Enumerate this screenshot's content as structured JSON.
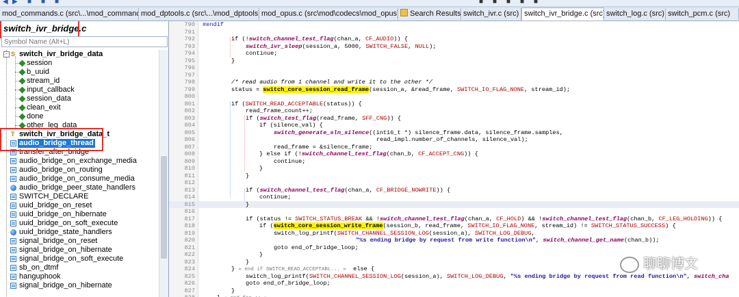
{
  "tabs": [
    {
      "label": "mod_commands.c (src\\...\\mod_commands)"
    },
    {
      "label": "mod_dptools.c (src\\...\\mod_dptools)"
    },
    {
      "label": "mod_opus.c (src\\mod\\codecs\\mod_opus)"
    },
    {
      "label": "Search Results"
    },
    {
      "label": "switch_ivr.c (src)"
    },
    {
      "label": "switch_ivr_bridge.c (src)",
      "close": "×"
    },
    {
      "label": "switch_log.c (src)"
    },
    {
      "label": "switch_pcm.c (src)"
    }
  ],
  "panel": {
    "title": "switch_ivr_bridge.c",
    "search_placeholder": "Symbol Name (Alt+L)"
  },
  "tree": [
    {
      "label": "switch_ivr_bridge_data",
      "expander": "-"
    },
    {
      "label": "session"
    },
    {
      "label": "b_uuid"
    },
    {
      "label": "stream_id"
    },
    {
      "label": "input_callback"
    },
    {
      "label": "session_data"
    },
    {
      "label": "clean_exit"
    },
    {
      "label": "done"
    },
    {
      "label": "other_leg_data"
    },
    {
      "label": "switch_ivr_bridge_data_t"
    },
    {
      "label": "audio_bridge_thread"
    },
    {
      "label": "transfer_after_bridge"
    },
    {
      "label": "audio_bridge_on_exchange_media"
    },
    {
      "label": "audio_bridge_on_routing"
    },
    {
      "label": "audio_bridge_on_consume_media"
    },
    {
      "label": "audio_bridge_peer_state_handlers"
    },
    {
      "label": "SWITCH_DECLARE"
    },
    {
      "label": "uuid_bridge_on_reset"
    },
    {
      "label": "uuid_bridge_on_hibernate"
    },
    {
      "label": "uuid_bridge_on_soft_execute"
    },
    {
      "label": "uuid_bridge_state_handlers"
    },
    {
      "label": "signal_bridge_on_reset"
    },
    {
      "label": "signal_bridge_on_hibernate"
    },
    {
      "label": "signal_bridge_on_soft_execute"
    },
    {
      "label": "sb_on_dtmf"
    },
    {
      "label": "hanguphook"
    },
    {
      "label": "signal_bridge_on_hibernate"
    }
  ],
  "code": [
    {
      "n": "790",
      "t": "#endif"
    },
    {
      "n": "791",
      "t": ""
    },
    {
      "n": "792",
      "t": "if (!switch_channel_test_flag(chan_a, CF_AUDIO)) {"
    },
    {
      "n": "793",
      "t": "switch_ivr_sleep(session_a, 5000, SWITCH_FALSE, NULL);"
    },
    {
      "n": "794",
      "t": "continue;"
    },
    {
      "n": "795",
      "t": "}"
    },
    {
      "n": "796",
      "t": ""
    },
    {
      "n": "797",
      "t": ""
    },
    {
      "n": "798",
      "t": "/* read audio from 1 channel and write it to the other */"
    },
    {
      "n": "799",
      "t": "status = switch_core_session_read_frame(session_a, &read_frame, SWITCH_IO_FLAG_NONE, stream_id);"
    },
    {
      "n": "800",
      "t": ""
    },
    {
      "n": "801",
      "t": "if (SWITCH_READ_ACCEPTABLE(status)) {"
    },
    {
      "n": "802",
      "t": "read_frame_count++;"
    },
    {
      "n": "803",
      "t": "if (switch_test_flag(read_frame, SFF_CNG)) {"
    },
    {
      "n": "804",
      "t": "if (silence_val) {"
    },
    {
      "n": "805",
      "t": "switch_generate_sln_silence((int16_t *) silence_frame.data, silence_frame.samples,"
    },
    {
      "n": "806",
      "t": "read_impl.number_of_channels, silence_val);"
    },
    {
      "n": "807",
      "t": "read_frame = &silence_frame;"
    },
    {
      "n": "808",
      "t": "} else if (!switch_channel_test_flag(chan_b, CF_ACCEPT_CNG)) {"
    },
    {
      "n": "809",
      "t": "continue;"
    },
    {
      "n": "810",
      "t": "}"
    },
    {
      "n": "811",
      "t": "}"
    },
    {
      "n": "812",
      "t": ""
    },
    {
      "n": "813",
      "t": "if (switch_channel_test_flag(chan_a, CF_BRIDGE_NOWRITE)) {"
    },
    {
      "n": "814",
      "t": "continue;"
    },
    {
      "n": "815",
      "t": "}"
    },
    {
      "n": "816",
      "t": ""
    },
    {
      "n": "817",
      "t": "if (status != SWITCH_STATUS_BREAK && !switch_channel_test_flag(chan_a, CF_HOLD) && !switch_channel_test_flag(chan_b, CF_LEG_HOLDING)) {"
    },
    {
      "n": "818",
      "t": "if (switch_core_session_write_frame(session_b, read_frame, SWITCH_IO_FLAG_NONE, stream_id) != SWITCH_STATUS_SUCCESS) {"
    },
    {
      "n": "819",
      "t": "switch_log_printf(SWITCH_CHANNEL_SESSION_LOG(session_a), SWITCH_LOG_DEBUG,"
    },
    {
      "n": "820",
      "t": "\"%s ending bridge by request from write function\\n\", switch_channel_get_name(chan_b));"
    },
    {
      "n": "821",
      "t": "goto end_of_bridge_loop;"
    },
    {
      "n": "822",
      "t": "}"
    },
    {
      "n": "823",
      "t": "}"
    },
    {
      "n": "824",
      "t": "} « end if SWITCH_READ_ACCEPTABL... » else {"
    },
    {
      "n": "825",
      "t": "switch_log_printf(SWITCH_CHANNEL_SESSION_LOG(session_a), SWITCH_LOG_DEBUG, \"%s ending bridge by request from read function\\n\", switch_cha"
    },
    {
      "n": "826",
      "t": "goto end_of_bridge_loop;"
    },
    {
      "n": "827",
      "t": "}"
    },
    {
      "n": "828",
      "t": "} « end for ;; »"
    }
  ],
  "watermark": "聊聊博文"
}
